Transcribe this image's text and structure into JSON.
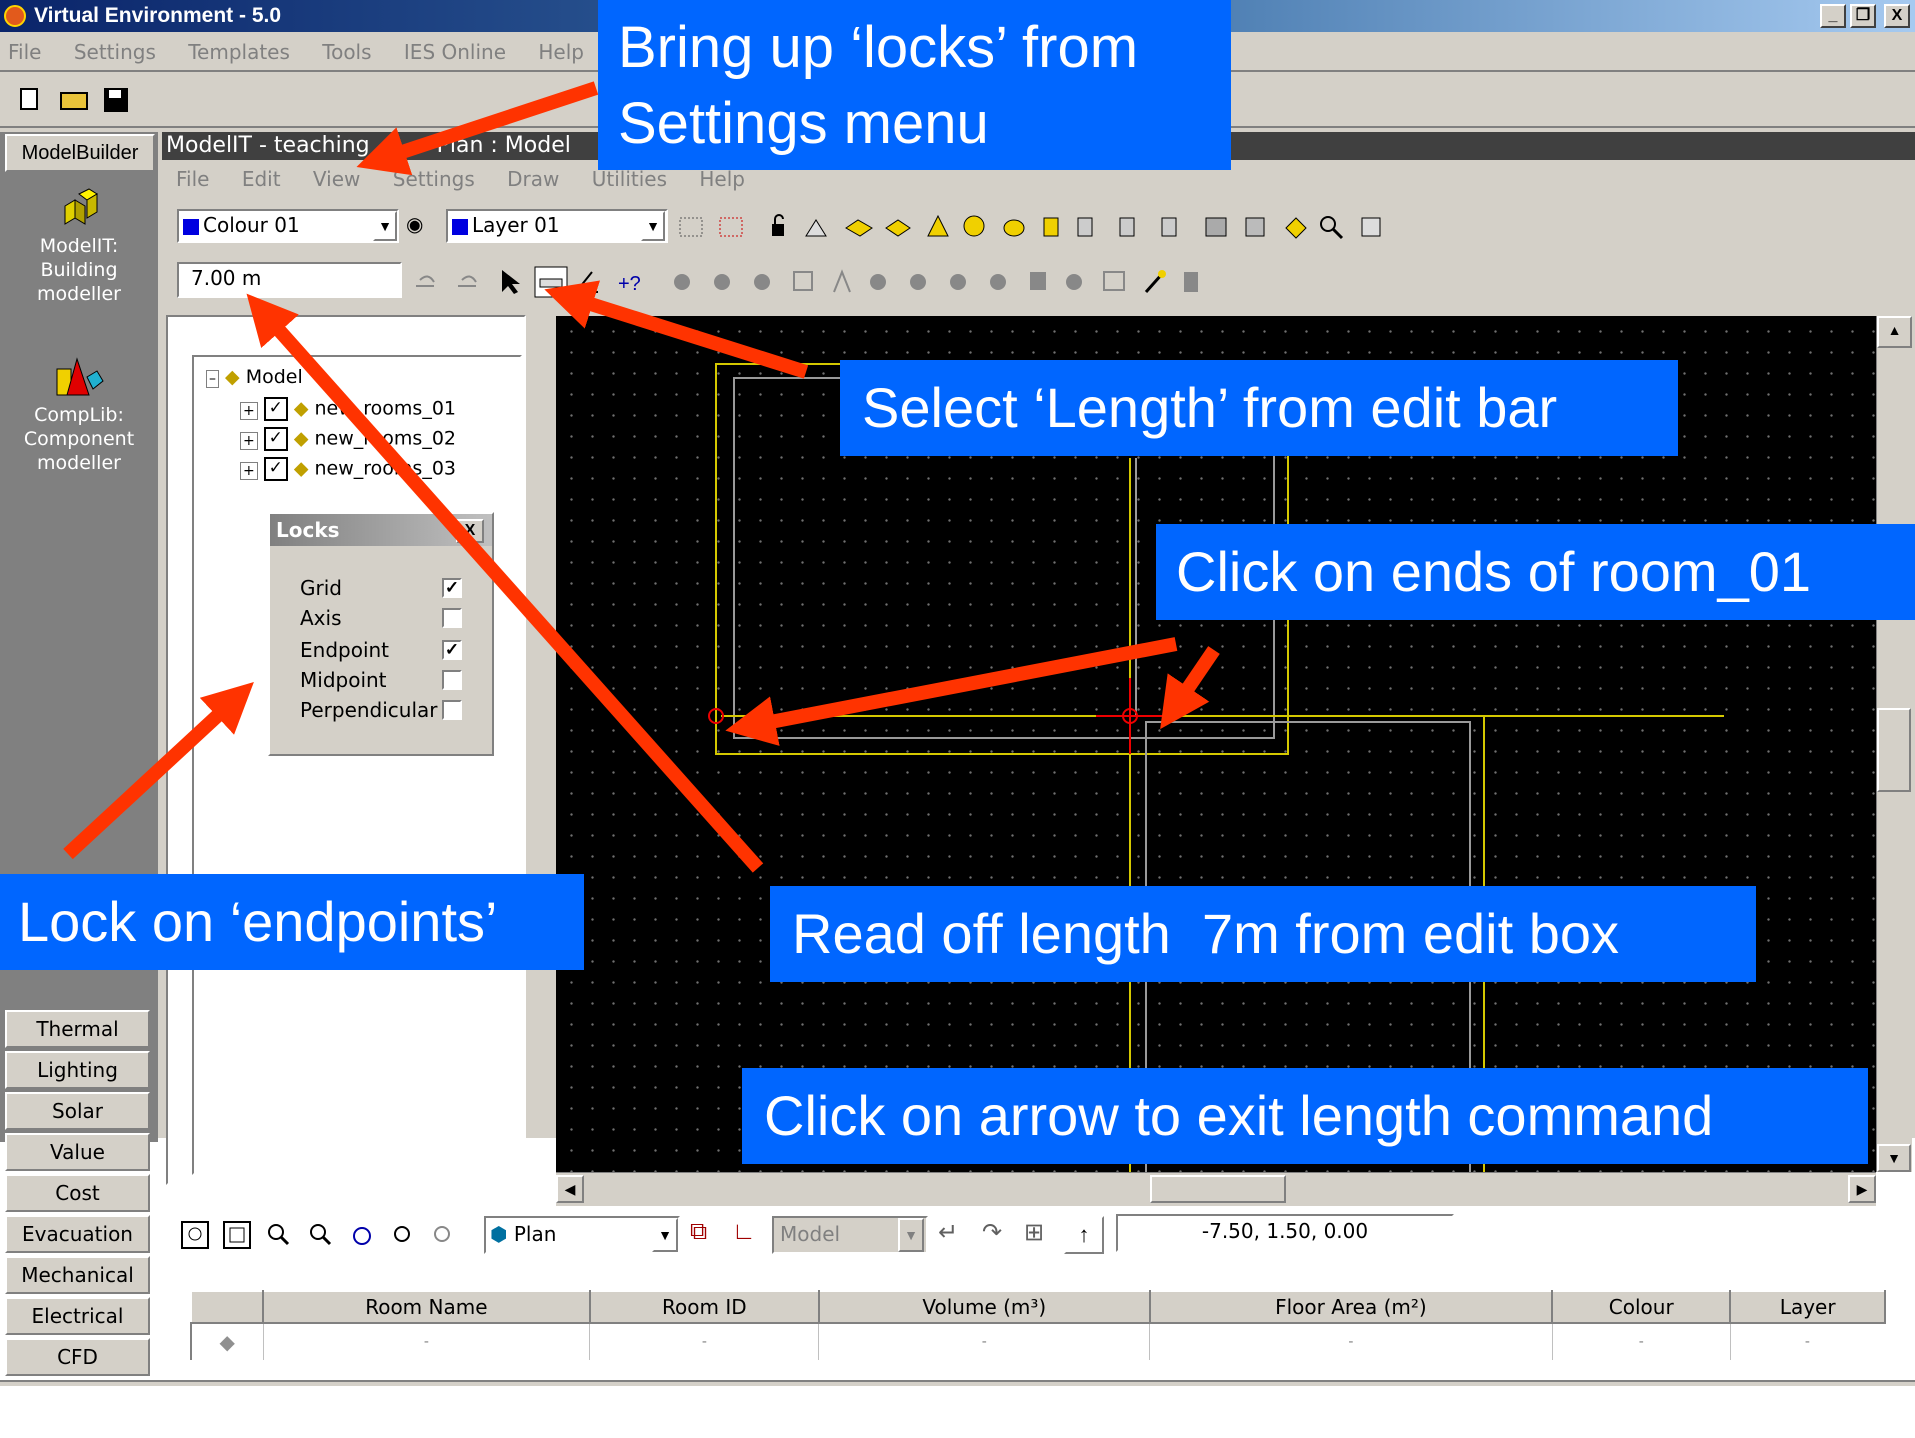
{
  "window": {
    "title": "Virtual Environment - 5.0",
    "controls": [
      "_",
      "²",
      "X"
    ]
  },
  "main_menu": [
    "File",
    "Settings",
    "Templates",
    "Tools",
    "IES Online",
    "Help"
  ],
  "sidebar": {
    "top_tab": "ModelBuilder",
    "modules": [
      {
        "label": "ModelIT:\nBuilding\nmodeller"
      },
      {
        "label": "CompLib:\nComponent\nmodeller"
      }
    ],
    "bottom_buttons": [
      "Thermal",
      "Lighting",
      "Solar",
      "Value",
      "Cost",
      "Evacuation",
      "Mechanical",
      "Electrical",
      "CFD"
    ]
  },
  "doc_window": {
    "title_left": "ModelIT - teaching",
    "title_right": "Plan : Model",
    "menu": [
      "File",
      "Edit",
      "View",
      "Settings",
      "Draw",
      "Utilities",
      "Help"
    ],
    "colour_select": "Colour 01",
    "layer_select": "Layer 01",
    "edit_box": "7.00 m",
    "view_select": "Plan",
    "model_select": "Model",
    "coords": "-7.50,   1.50,   0.00"
  },
  "tree": {
    "root": "Model",
    "items": [
      "new_rooms_01",
      "new_rooms_02",
      "new_rooms_03"
    ]
  },
  "locks": {
    "title": "Locks",
    "close": "X",
    "options": [
      {
        "label": "Grid",
        "checked": true
      },
      {
        "label": "Axis",
        "checked": false
      },
      {
        "label": "Endpoint",
        "checked": true
      },
      {
        "label": "Midpoint",
        "checked": false
      },
      {
        "label": "Perpendicular",
        "checked": false
      }
    ]
  },
  "table": {
    "columns": [
      "Room Name",
      "Room ID",
      "Volume (m³)",
      "Floor Area (m²)",
      "Colour",
      "Layer"
    ],
    "row": [
      "-",
      "-",
      "-",
      "-",
      "-",
      "-"
    ]
  },
  "callouts": {
    "settings": "Bring up ‘locks’ from\nSettings menu",
    "length": "Select ‘Length’ from edit bar",
    "ends": "Click on ends of room_01",
    "endpoints": "Lock on ‘endpoints’",
    "read": "Read off length  7m from edit box",
    "exit": "Click on arrow to exit length command"
  },
  "colors": {
    "callout_bg": "#0066ff",
    "arrow": "#ff3300",
    "canvas": "#000000",
    "room_outline": "#d4c800"
  }
}
